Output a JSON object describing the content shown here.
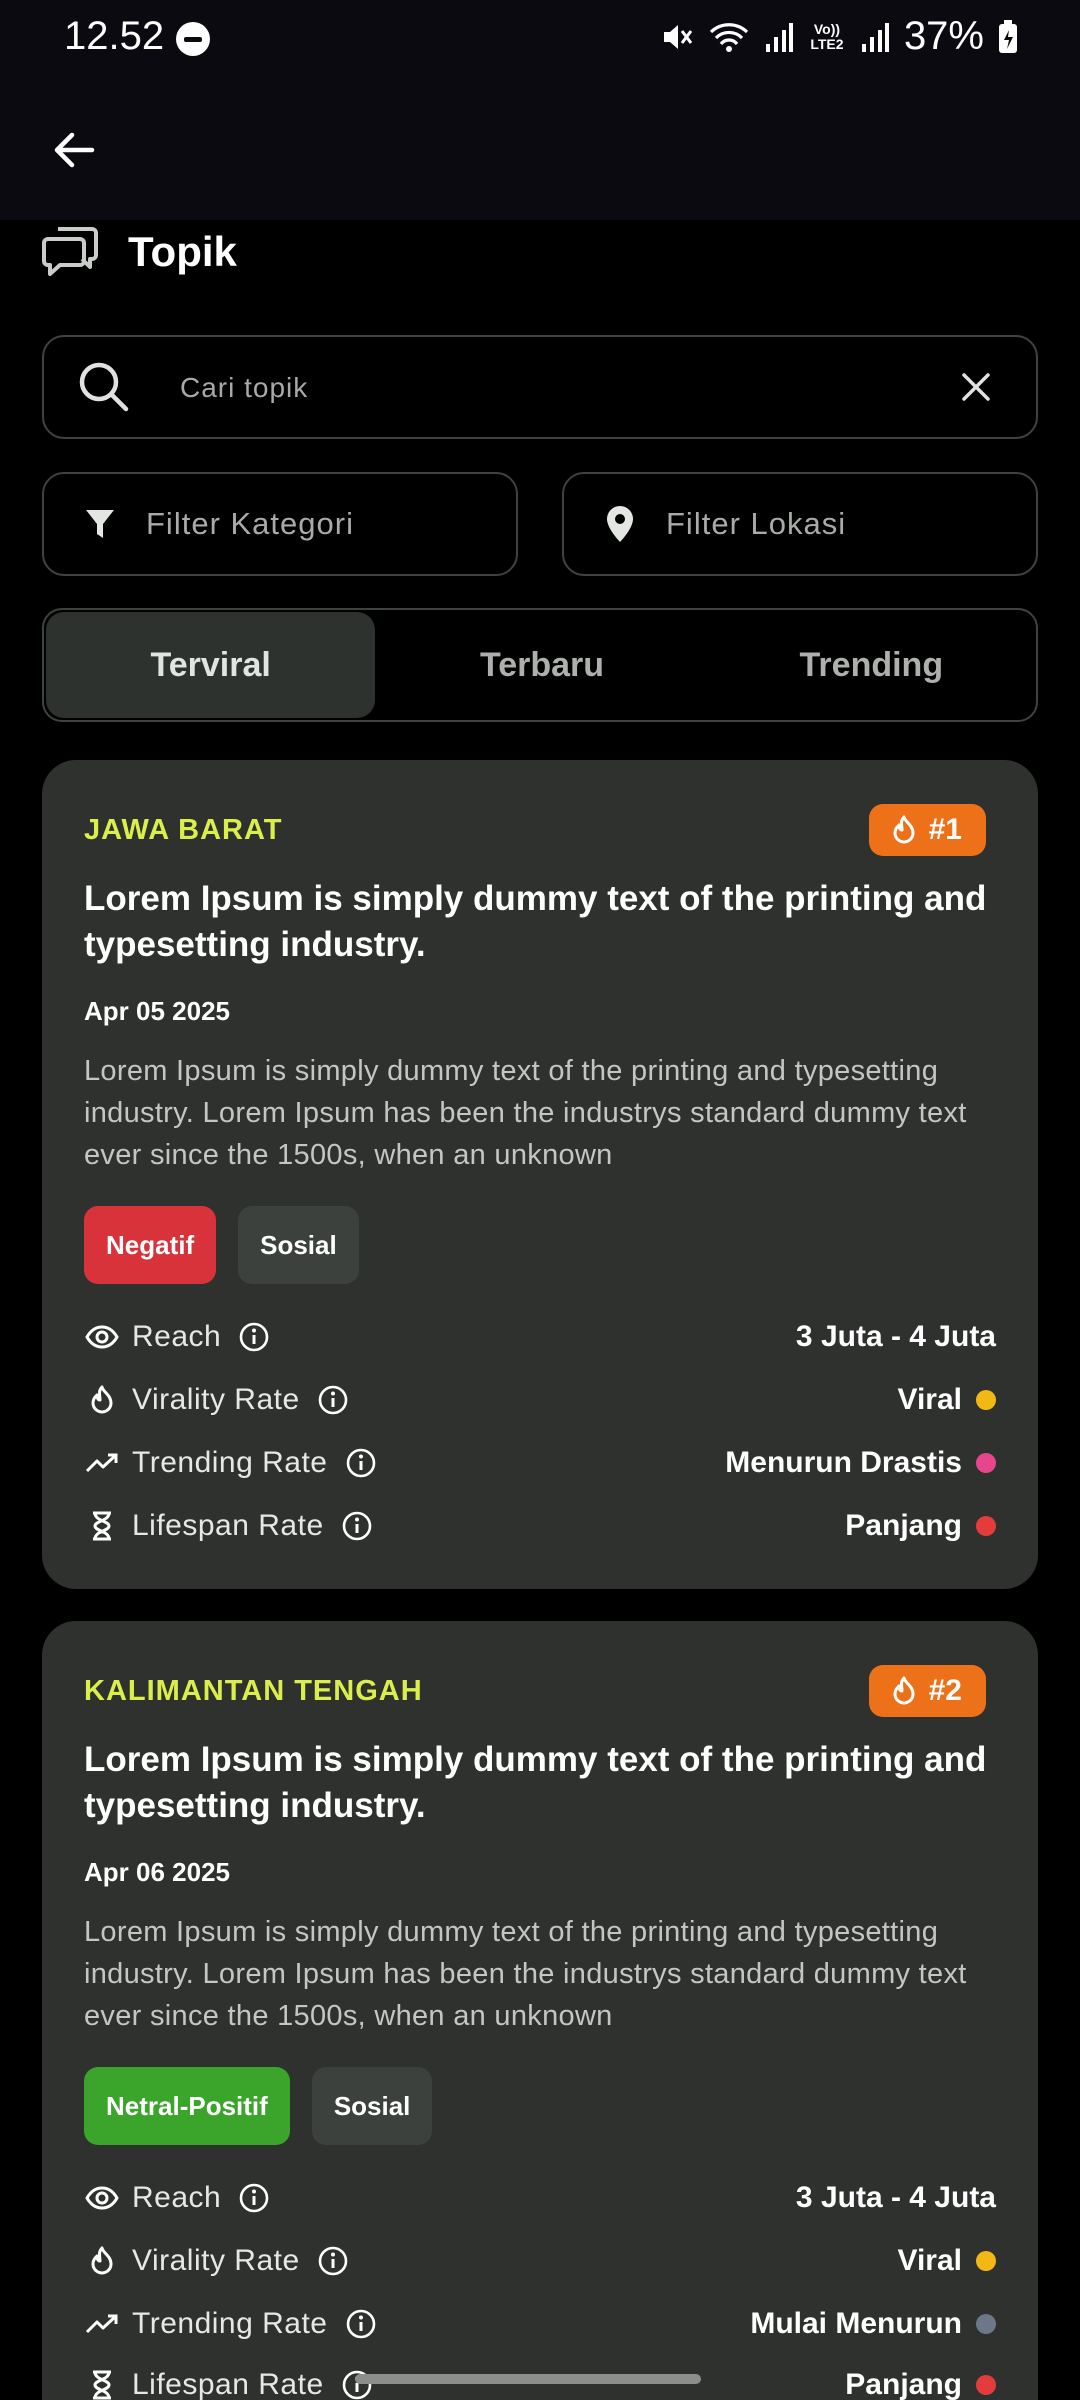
{
  "status_bar": {
    "time": "12.52",
    "battery": "37%",
    "network_label": "Vo)) LTE2"
  },
  "app_bar": {
    "back_icon": "arrow-left-icon"
  },
  "page": {
    "title": "Topik",
    "title_icon": "chat-bubbles-icon"
  },
  "search": {
    "placeholder": "Cari topik"
  },
  "filters": {
    "category": "Filter Kategori",
    "location": "Filter Lokasi"
  },
  "tabs": [
    {
      "label": "Terviral",
      "active": true
    },
    {
      "label": "Terbaru",
      "active": false
    },
    {
      "label": "Trending",
      "active": false
    }
  ],
  "metric_labels": {
    "reach": "Reach",
    "virality": "Virality Rate",
    "trending": "Trending Rate",
    "lifespan": "Lifespan Rate"
  },
  "colors": {
    "accent_region": "#dcee4a",
    "rank_badge": "#ec7118",
    "sentiment_negative": "#d8323a",
    "sentiment_positive": "#3aa52a",
    "dot_viral": "#f2b814",
    "dot_drastic": "#e8458f",
    "dot_mild": "#6e7787",
    "dot_long": "#e43c3c"
  },
  "topics": [
    {
      "region": "JAWA BARAT",
      "rank": "#1",
      "title": "Lorem Ipsum is simply dummy text of the printing and typesetting industry.",
      "date": "Apr 05 2025",
      "description": "Lorem Ipsum is simply dummy text of the printing and typesetting industry. Lorem Ipsum has been the industrys standard dummy text ever since the 1500s, when an unknown",
      "sentiment": "Negatif",
      "category": "Sosial",
      "reach": "3 Juta - 4 Juta",
      "virality": "Viral",
      "trending": "Menurun Drastis",
      "lifespan": "Panjang"
    },
    {
      "region": "KALIMANTAN TENGAH",
      "rank": "#2",
      "title": "Lorem Ipsum is simply dummy text of the printing and typesetting industry.",
      "date": "Apr 06 2025",
      "description": "Lorem Ipsum is simply dummy text of the printing and typesetting industry. Lorem Ipsum has been the industrys standard dummy text ever since the 1500s, when an unknown",
      "sentiment": "Netral-Positif",
      "category": "Sosial",
      "reach": "3 Juta - 4 Juta",
      "virality": "Viral",
      "trending": "Mulai Menurun",
      "lifespan": "Panjang"
    }
  ]
}
